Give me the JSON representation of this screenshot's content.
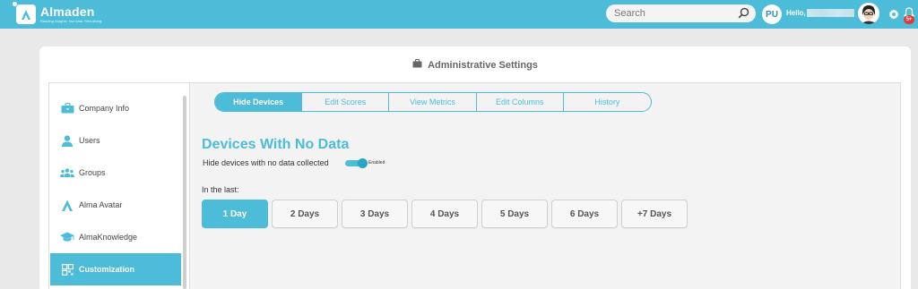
{
  "app": {
    "name": "Almaden",
    "tagline": "Reading insights. Not data. Rebuilding"
  },
  "topbar": {
    "search_placeholder": "Search",
    "user_initials": "PU",
    "greeting": "Hello,",
    "notification_count": "5+"
  },
  "page": {
    "title": "Administrative Settings"
  },
  "sidebar": {
    "items": [
      {
        "label": "Company Info",
        "icon": "briefcase-icon"
      },
      {
        "label": "Users",
        "icon": "user-icon"
      },
      {
        "label": "Groups",
        "icon": "groups-icon"
      },
      {
        "label": "Alma Avatar",
        "icon": "alma-avatar-icon"
      },
      {
        "label": "AlmaKnowledge",
        "icon": "graduation-cap-icon"
      },
      {
        "label": "Customization",
        "icon": "grid-icon",
        "active": true
      }
    ]
  },
  "tabs": [
    {
      "label": "Hide Devices",
      "active": true
    },
    {
      "label": "Edit Scores"
    },
    {
      "label": "View Metrics"
    },
    {
      "label": "Edit Columns"
    },
    {
      "label": "History"
    }
  ],
  "content": {
    "section_title": "Devices With No Data",
    "toggle_label": "Hide devices with no data collected",
    "toggle_state": "Enabled",
    "toggle_on": true,
    "in_last_label": "In the last:",
    "day_options": [
      "1 Day",
      "2 Days",
      "3 Days",
      "4 Days",
      "5 Days",
      "6 Days",
      "+7 Days"
    ],
    "selected_day": "1 Day"
  },
  "colors": {
    "accent": "#4cbcd9",
    "badge": "#e53935",
    "background": "#e9e9e9"
  }
}
